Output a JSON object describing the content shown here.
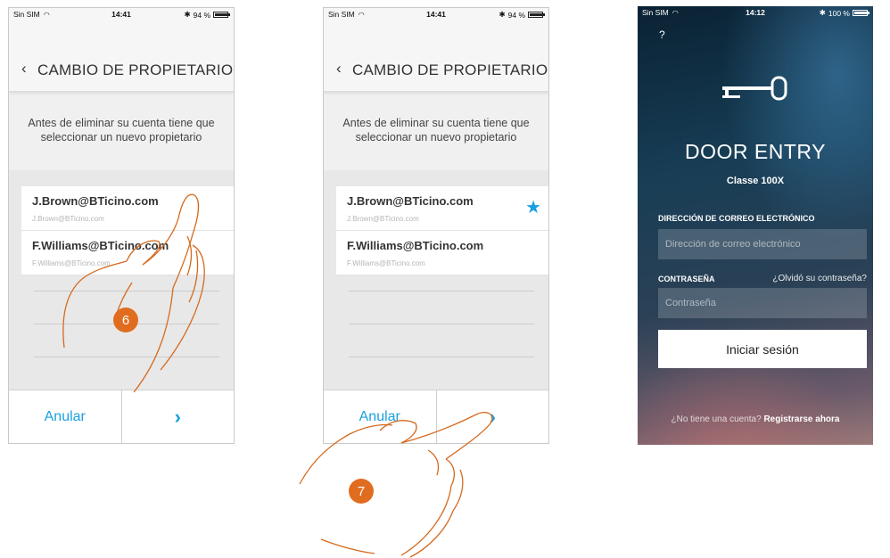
{
  "screen1": {
    "status": {
      "carrier": "Sin SIM",
      "time": "14:41",
      "battery": "94 %",
      "battery_level": 0.94
    },
    "title": "CAMBIO DE PROPIETARIO",
    "description_line1": "Antes de eliminar su cuenta tiene que",
    "description_line2": "seleccionar un nuevo propietario",
    "accounts": [
      {
        "email": "J.Brown@BTicino.com",
        "sub": "J.Brown@BTicino.com",
        "selected": false
      },
      {
        "email": "F.Williams@BTicino.com",
        "sub": "F.Williams@BTicino.com",
        "selected": false
      }
    ],
    "cancel_label": "Anular",
    "next_label": "›",
    "step_badge": "6"
  },
  "screen2": {
    "status": {
      "carrier": "Sin SIM",
      "time": "14:41",
      "battery": "94 %",
      "battery_level": 0.94
    },
    "title": "CAMBIO DE PROPIETARIO",
    "description_line1": "Antes de eliminar su cuenta tiene que",
    "description_line2": "seleccionar un nuevo propietario",
    "accounts": [
      {
        "email": "J.Brown@BTicino.com",
        "sub": "J.Brown@BTicino.com",
        "selected": true
      },
      {
        "email": "F.Williams@BTicino.com",
        "sub": "F.Williams@BTicino.com",
        "selected": false
      }
    ],
    "cancel_label": "Anular",
    "next_label": "›",
    "step_badge": "7",
    "accent_color": "#1a9fe0"
  },
  "screen3": {
    "status": {
      "carrier": "Sin SIM",
      "time": "14:12",
      "battery": "100 %",
      "battery_level": 1.0
    },
    "help": "?",
    "app_title": "DOOR ENTRY",
    "app_subtitle": "Classe 100X",
    "email_label": "DIRECCIÓN DE CORREO ELECTRÓNICO",
    "email_placeholder": "Dirección de correo electrónico",
    "password_label": "CONTRASEÑA",
    "forgot_label": "¿Olvidó su contraseña?",
    "password_placeholder": "Contraseña",
    "login_label": "Iniciar sesión",
    "no_account": "¿No tiene una cuenta?",
    "register": "Registrarse ahora"
  },
  "badge_color": "#e06d1f"
}
